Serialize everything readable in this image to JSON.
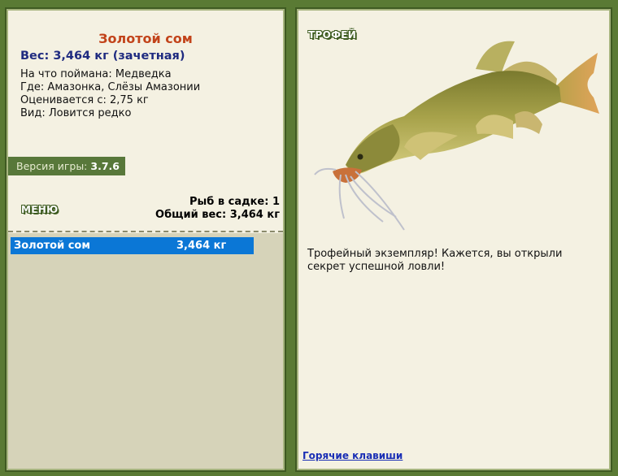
{
  "fish": {
    "title": "Золотой сом",
    "weight_line": "Вес: 3,464 кг (зачетная)",
    "bait": "На что поймана: Медведка",
    "location": "Где: Амазонка, Слёзы Амазонии",
    "rated_from": "Оценивается с: 2,75 кг",
    "kind": "Вид: Ловится редко"
  },
  "version": {
    "label": "Версия игры:",
    "value": "3.7.6"
  },
  "menu": {
    "label": "МЕНЮ"
  },
  "keepnet": {
    "fish_count": "Рыб в садке: 1",
    "total_weight": "Общий вес: 3,464 кг",
    "items": [
      {
        "name": "Золотой сом",
        "weight": "3,464 кг",
        "selected": true
      }
    ]
  },
  "trophy": {
    "label": "ТРОФЕЙ",
    "text": "Трофейный экземпляр! Кажется, вы открыли секрет успешной ловли!"
  },
  "footer": {
    "hotkeys": "Горячие клавиши"
  },
  "colors": {
    "frame": "#5a7a34",
    "panel": "#f4f1e2",
    "title": "#c2431a",
    "weight": "#1f2b80",
    "selection": "#0b77d6",
    "link": "#1a2fb5"
  },
  "icons": {
    "fish": "catfish-image"
  }
}
